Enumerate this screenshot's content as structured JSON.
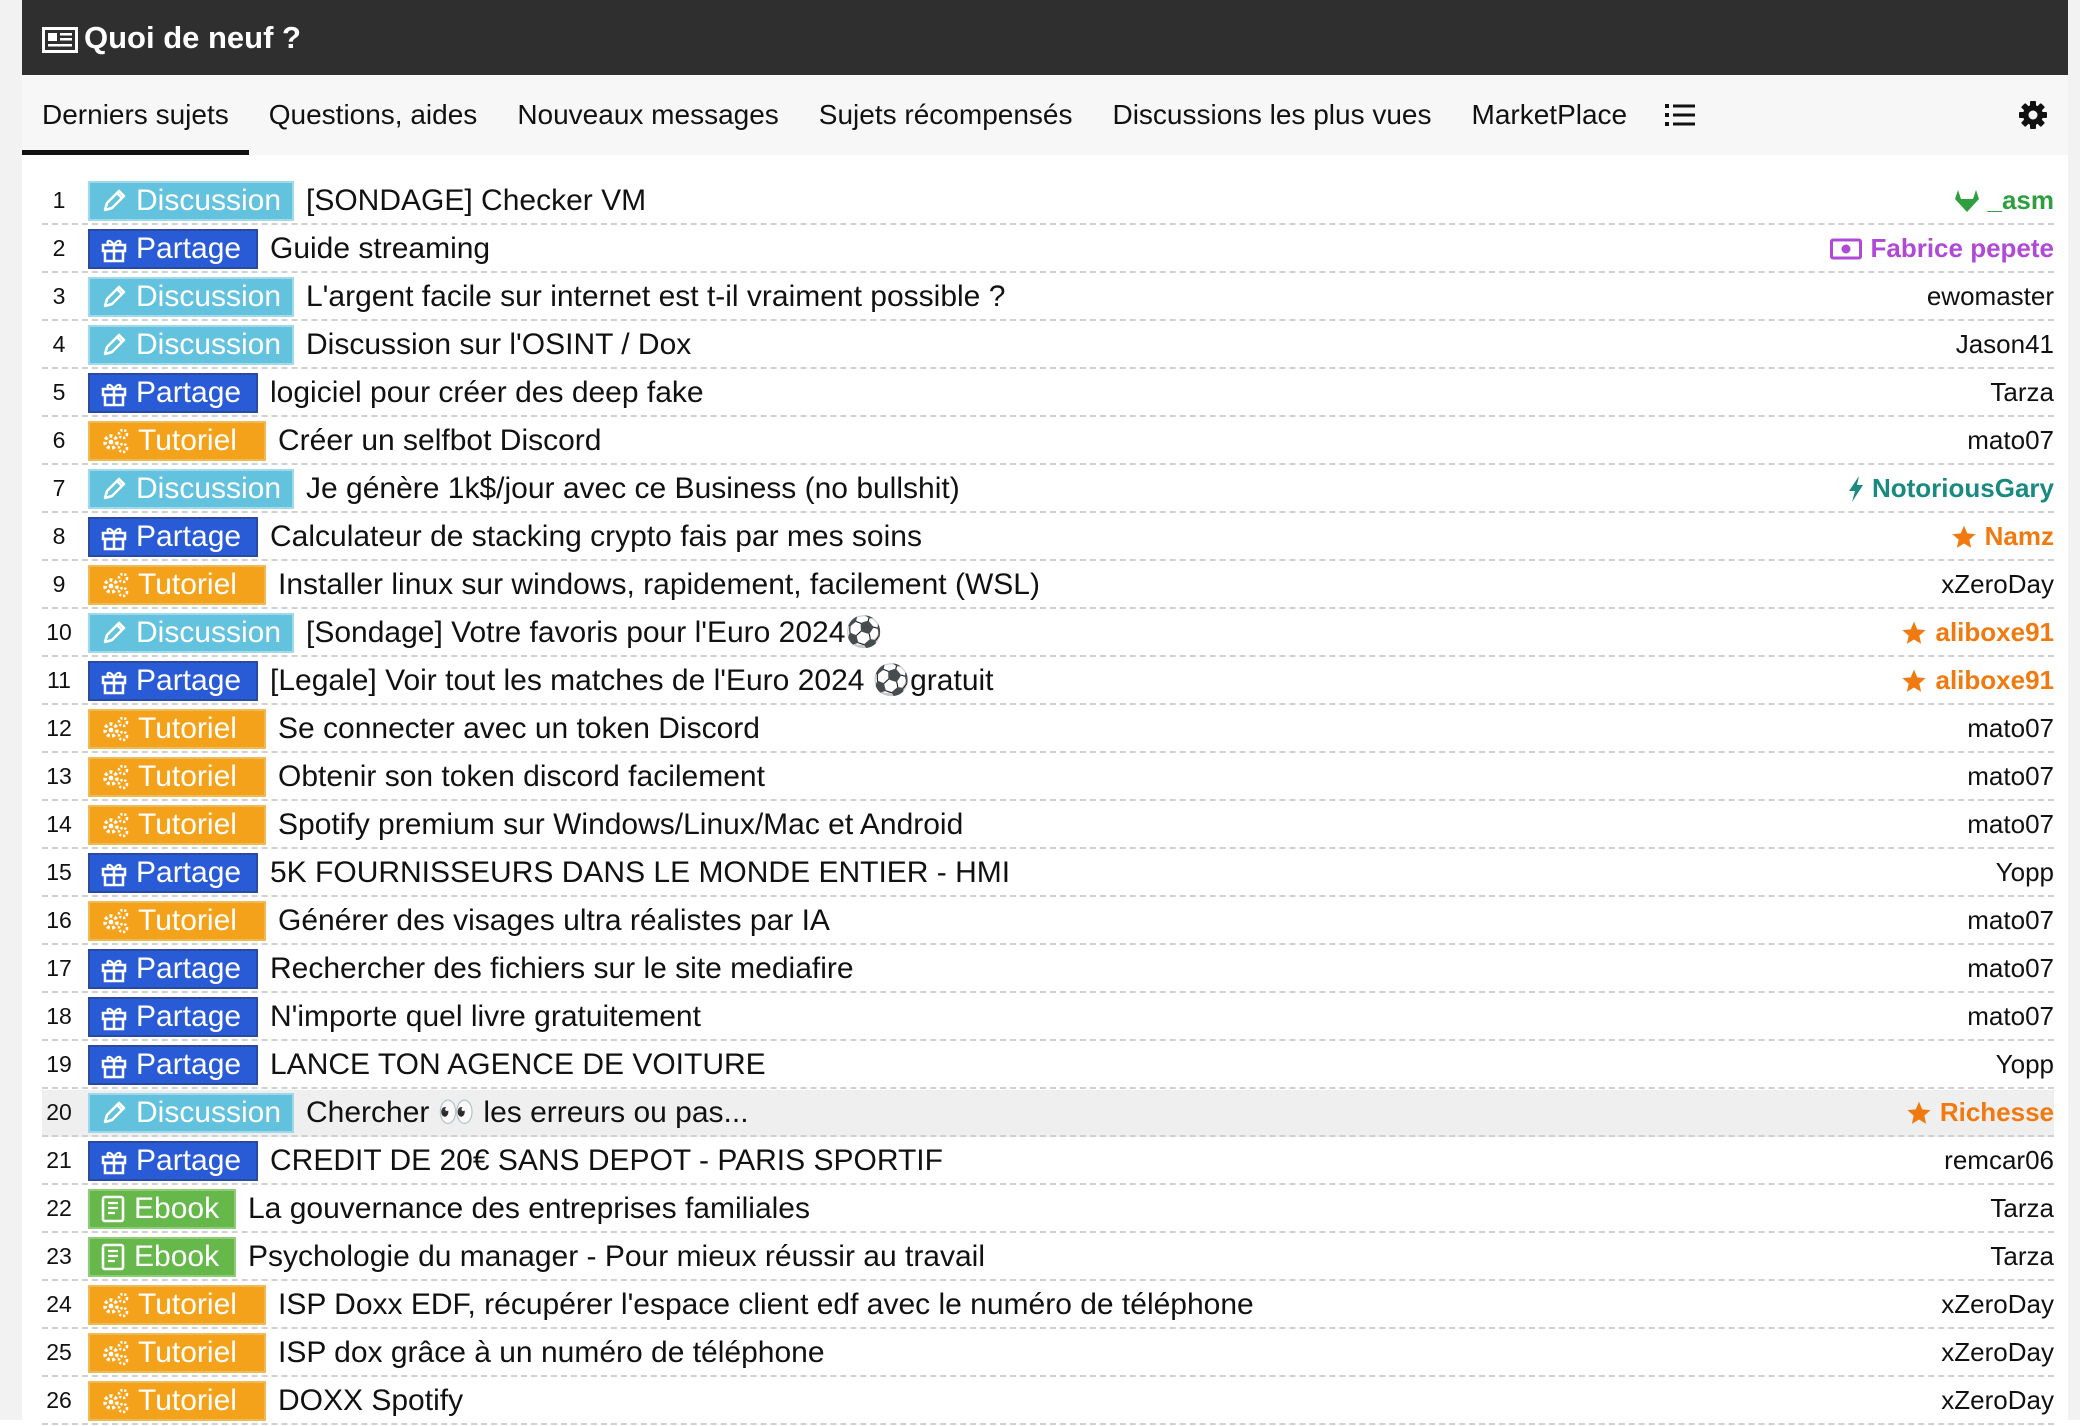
{
  "header": {
    "title": "Quoi de neuf ?"
  },
  "tabs": [
    {
      "label": "Derniers sujets",
      "active": true
    },
    {
      "label": "Questions, aides",
      "active": false
    },
    {
      "label": "Nouveaux messages",
      "active": false
    },
    {
      "label": "Sujets récompensés",
      "active": false
    },
    {
      "label": "Discussions les plus vues",
      "active": false
    },
    {
      "label": "MarketPlace",
      "active": false
    }
  ],
  "category_colors": {
    "discussion": "#5bc0de",
    "partage": "#2a5bd6",
    "tutoriel": "#f5a21b",
    "ebook": "#66b84a"
  },
  "rows": [
    {
      "num": "1",
      "category": "Discussion",
      "title": "[SONDAGE] Checker VM",
      "author": "_asm",
      "author_style": "green",
      "author_icon": "gitlab-icon"
    },
    {
      "num": "2",
      "category": "Partage",
      "title": "Guide streaming",
      "author": "Fabrice pepete",
      "author_style": "purple",
      "author_icon": "money-icon"
    },
    {
      "num": "3",
      "category": "Discussion",
      "title": "L'argent facile sur internet est t-il vraiment possible ?",
      "author": "ewomaster"
    },
    {
      "num": "4",
      "category": "Discussion",
      "title": "Discussion sur l'OSINT / Dox",
      "author": "Jason41"
    },
    {
      "num": "5",
      "category": "Partage",
      "title": "logiciel pour créer des deep fake",
      "author": "Tarza"
    },
    {
      "num": "6",
      "category": "Tutoriel",
      "title": "Créer un selfbot Discord",
      "author": "mato07"
    },
    {
      "num": "7",
      "category": "Discussion",
      "title": "Je génère 1k$/jour avec ce Business (no bullshit)",
      "author": "NotoriousGary",
      "author_style": "teal",
      "author_icon": "bolt-icon"
    },
    {
      "num": "8",
      "category": "Partage",
      "title": "Calculateur de stacking crypto fais par mes soins",
      "author": "Namz",
      "author_style": "orange",
      "author_icon": "star-icon"
    },
    {
      "num": "9",
      "category": "Tutoriel",
      "title": "Installer linux sur windows, rapidement, facilement (WSL)",
      "author": "xZeroDay"
    },
    {
      "num": "10",
      "category": "Discussion",
      "title": "[Sondage] Votre favoris pour l'Euro 2024⚽",
      "author": "aliboxe91",
      "author_style": "orange",
      "author_icon": "star-icon"
    },
    {
      "num": "11",
      "category": "Partage",
      "title": "[Legale] Voir tout les matches de l'Euro 2024 ⚽gratuit",
      "author": "aliboxe91",
      "author_style": "orange",
      "author_icon": "star-icon"
    },
    {
      "num": "12",
      "category": "Tutoriel",
      "title": "Se connecter avec un token Discord",
      "author": "mato07"
    },
    {
      "num": "13",
      "category": "Tutoriel",
      "title": "Obtenir son token discord facilement",
      "author": "mato07"
    },
    {
      "num": "14",
      "category": "Tutoriel",
      "title": "Spotify premium sur Windows/Linux/Mac et Android",
      "author": "mato07"
    },
    {
      "num": "15",
      "category": "Partage",
      "title": "5K FOURNISSEURS DANS LE MONDE ENTIER - HMI",
      "author": "Yopp"
    },
    {
      "num": "16",
      "category": "Tutoriel",
      "title": "Générer des visages ultra réalistes par IA",
      "author": "mato07"
    },
    {
      "num": "17",
      "category": "Partage",
      "title": "Rechercher des fichiers sur le site mediafire",
      "author": "mato07"
    },
    {
      "num": "18",
      "category": "Partage",
      "title": "N'importe quel livre gratuitement",
      "author": "mato07"
    },
    {
      "num": "19",
      "category": "Partage",
      "title": "LANCE TON AGENCE DE VOITURE",
      "author": "Yopp"
    },
    {
      "num": "20",
      "category": "Discussion",
      "title": "Chercher 👀 les erreurs ou pas...",
      "author": "Richesse",
      "author_style": "orange",
      "author_icon": "star-icon",
      "highlight": true
    },
    {
      "num": "21",
      "category": "Partage",
      "title": "CREDIT DE 20€ SANS DEPOT - PARIS SPORTIF",
      "author": "remcar06"
    },
    {
      "num": "22",
      "category": "Ebook",
      "title": "La gouvernance des entreprises familiales",
      "author": "Tarza"
    },
    {
      "num": "23",
      "category": "Ebook",
      "title": "Psychologie du manager - Pour mieux réussir au travail",
      "author": "Tarza"
    },
    {
      "num": "24",
      "category": "Tutoriel",
      "title": "ISP Doxx EDF, récupérer l'espace client edf avec le numéro de téléphone",
      "author": "xZeroDay"
    },
    {
      "num": "25",
      "category": "Tutoriel",
      "title": "ISP dox grâce à un numéro de téléphone",
      "author": "xZeroDay"
    },
    {
      "num": "26",
      "category": "Tutoriel",
      "title": "DOXX Spotify",
      "author": "xZeroDay"
    }
  ]
}
